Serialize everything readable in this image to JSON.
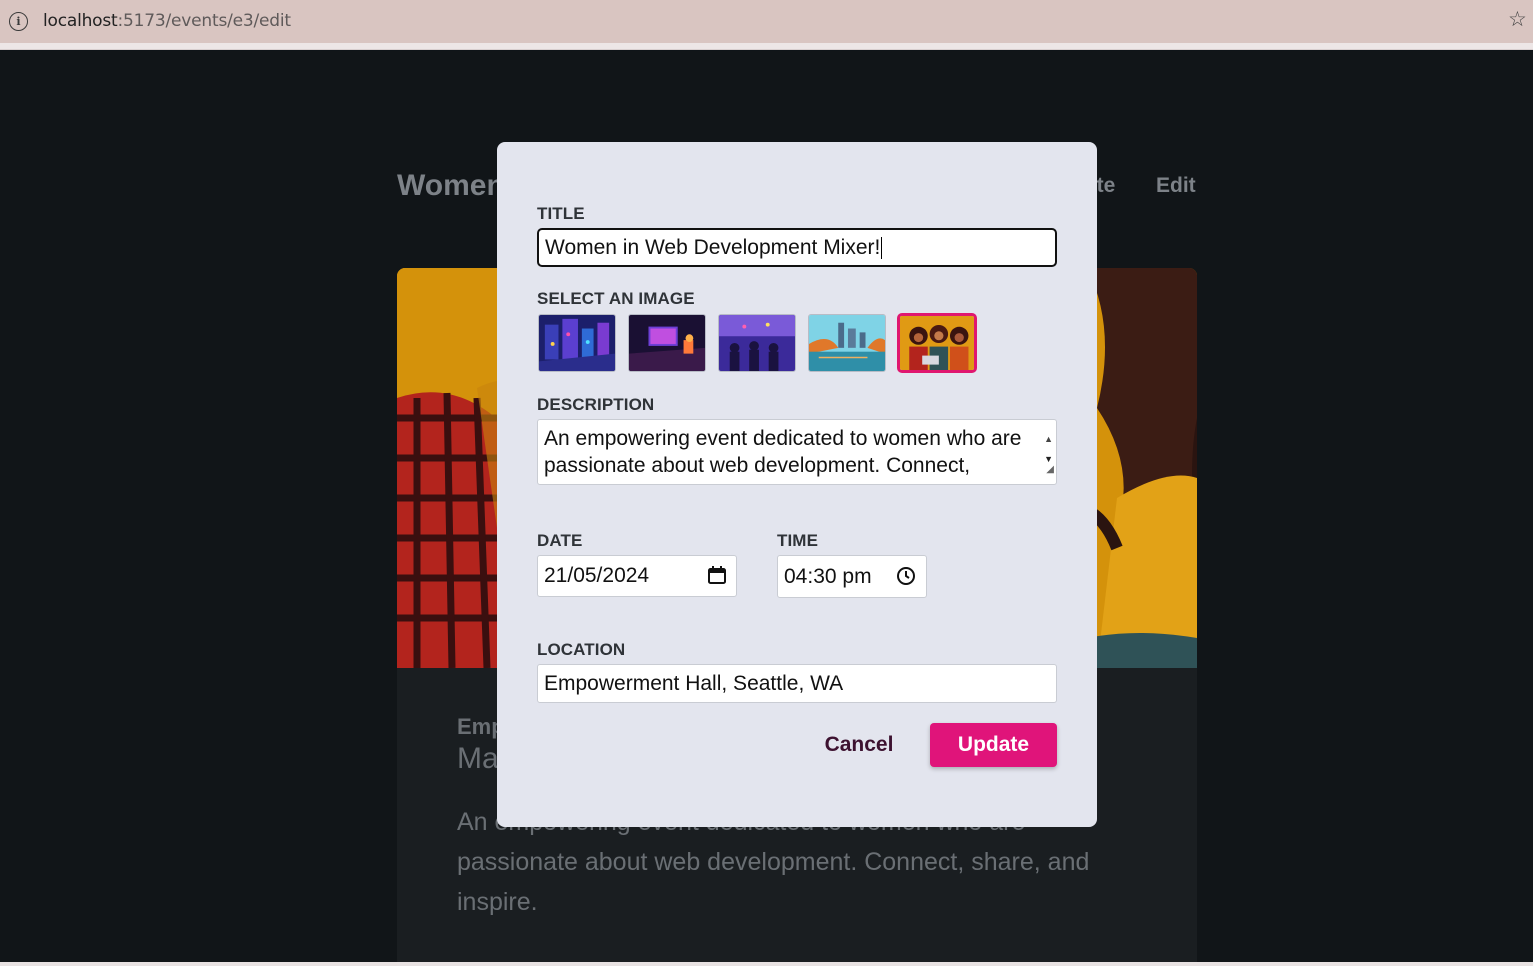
{
  "browser": {
    "url_host": "localhost",
    "url_path": ":5173/events/e3/edit"
  },
  "background_page": {
    "title_visible": "Women",
    "nav_delete": "ete",
    "nav_edit": "Edit",
    "card_location": "Emp",
    "card_date": "Ma",
    "card_description": "An empowering event dedicated to women who are passionate about web development. Connect, share, and inspire."
  },
  "modal": {
    "title_label": "TITLE",
    "title_value": "Women in Web Development Mixer!",
    "image_label": "SELECT AN IMAGE",
    "images": [
      {
        "name": "isometric-city",
        "selected": false
      },
      {
        "name": "developer-desk",
        "selected": false
      },
      {
        "name": "meetup-crowd",
        "selected": false
      },
      {
        "name": "city-river",
        "selected": false
      },
      {
        "name": "women-coding",
        "selected": true
      }
    ],
    "description_label": "DESCRIPTION",
    "description_value": "An empowering event dedicated to women who are passionate about web development. Connect,",
    "date_label": "DATE",
    "date_value": "21/05/2024",
    "time_label": "TIME",
    "time_value": "04:30 pm",
    "location_label": "LOCATION",
    "location_value": "Empowerment Hall, Seattle, WA",
    "cancel_label": "Cancel",
    "update_label": "Update"
  },
  "colors": {
    "accent": "#e0147a",
    "modal_bg": "#e3e5ee",
    "page_bg": "#111518"
  }
}
